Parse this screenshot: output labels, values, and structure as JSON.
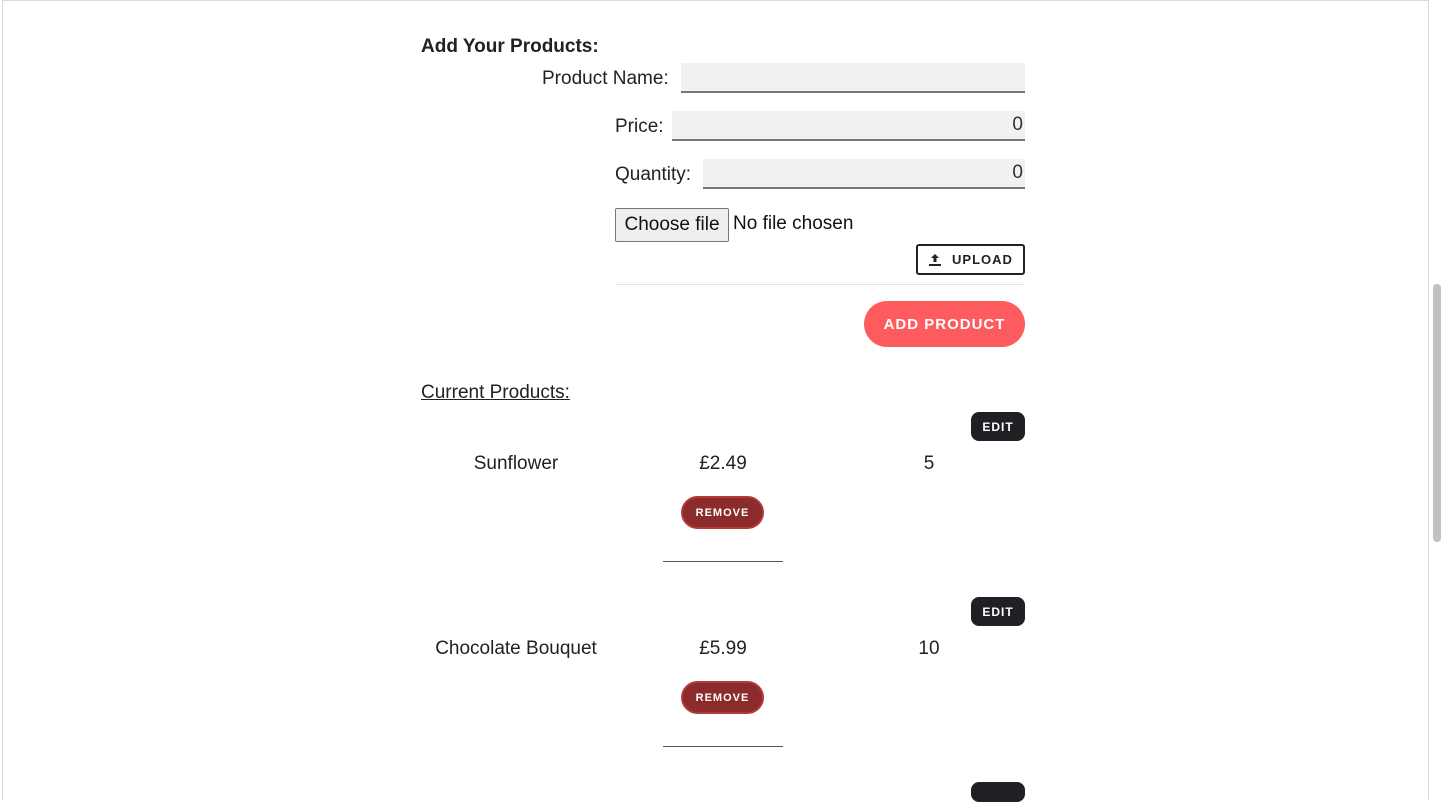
{
  "form": {
    "heading": "Add Your Products:",
    "product_name_label": "Product Name:",
    "product_name_value": "",
    "price_label": "Price:",
    "price_value": "0",
    "quantity_label": "Quantity:",
    "quantity_value": "0",
    "choose_file_label": "Choose file",
    "file_status": "No file chosen",
    "upload_label": "UPLOAD",
    "add_product_label": "ADD PRODUCT"
  },
  "products": {
    "title": "Current Products:",
    "edit_label": "EDIT",
    "remove_label": "REMOVE",
    "items": [
      {
        "name": "Sunflower",
        "price": "£2.49",
        "quantity": "5"
      },
      {
        "name": "Chocolate Bouquet",
        "price": "£5.99",
        "quantity": "10"
      }
    ]
  },
  "icons": {
    "upload": "upload-icon"
  },
  "colors": {
    "add_button": "#fe5b5f",
    "remove_button": "#8c2b2b",
    "edit_button": "#1f1f24"
  }
}
